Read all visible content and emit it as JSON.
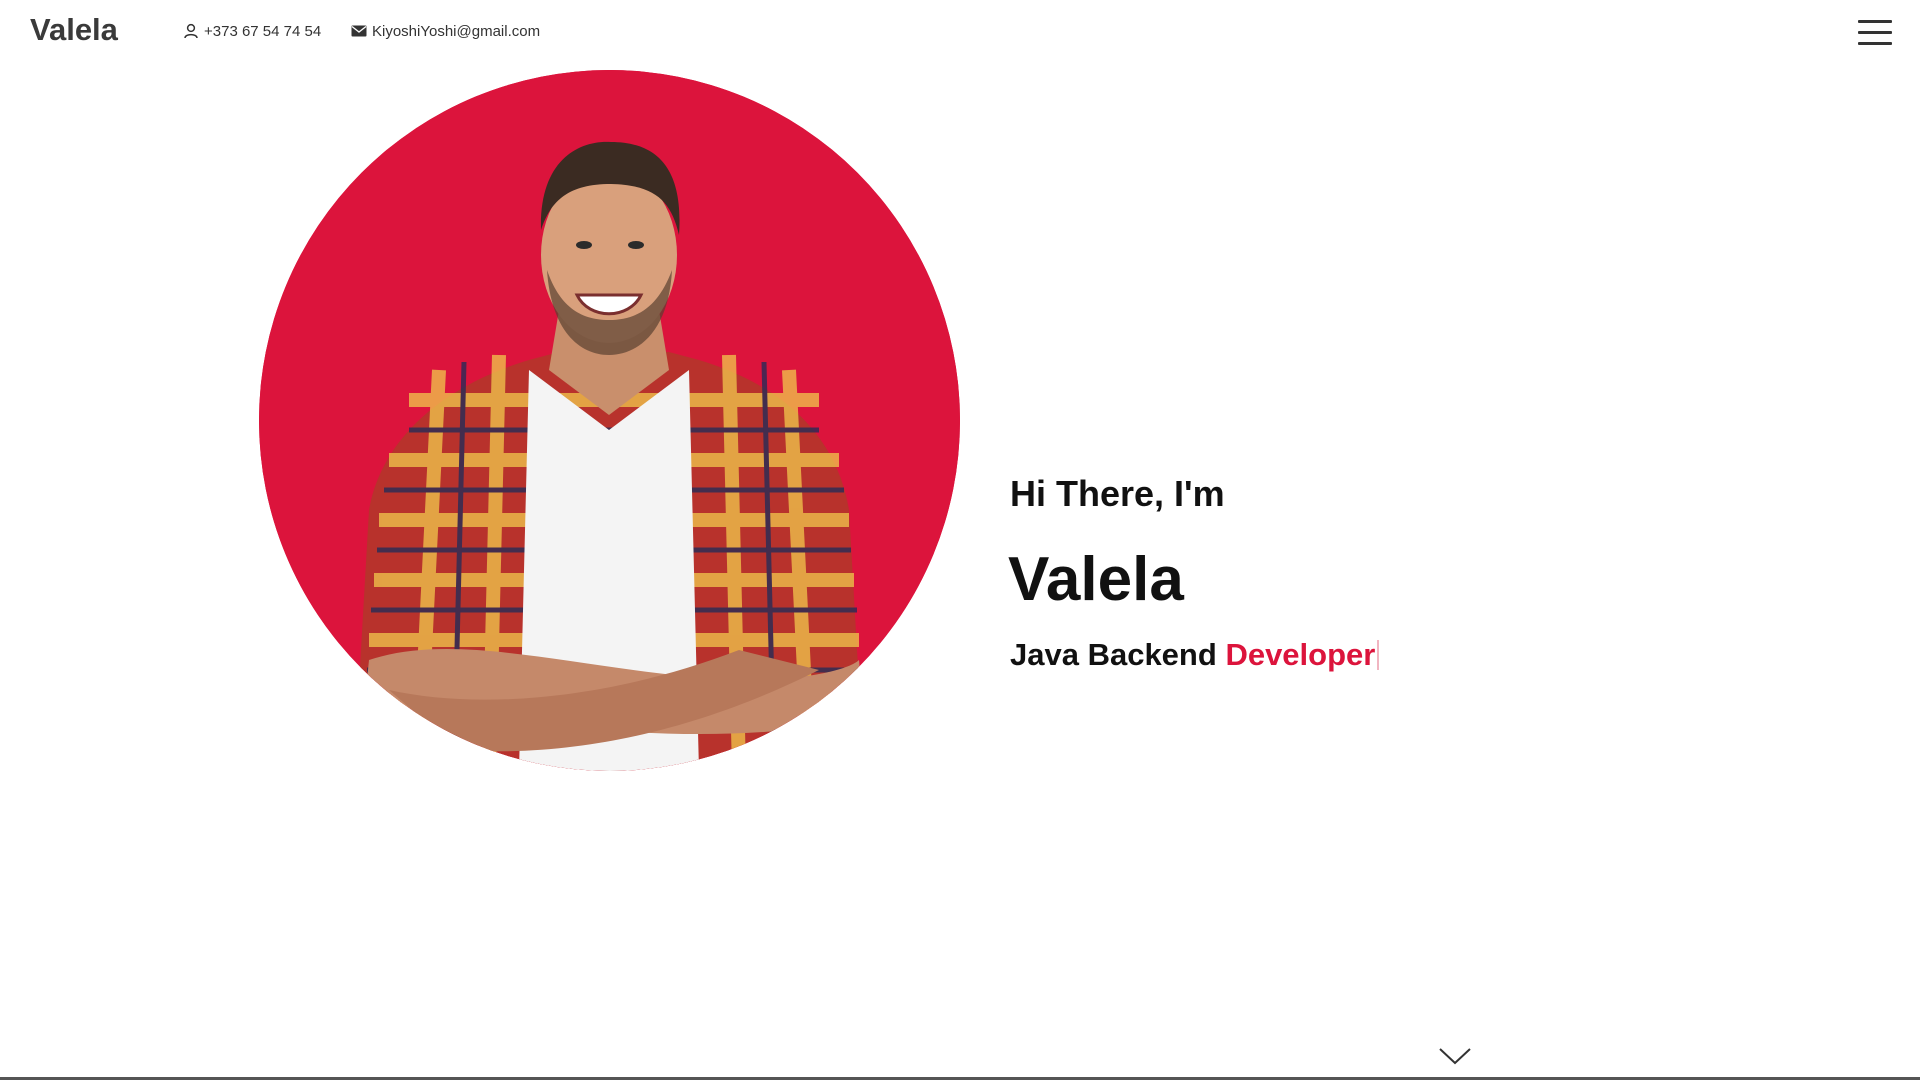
{
  "header": {
    "brand": "Valela",
    "phone": "+373 67 54 74 54",
    "email": "KiyoshiYoshi@gmail.com",
    "phone_icon": "user-icon",
    "email_icon": "envelope-icon",
    "menu_icon": "hamburger-menu-icon"
  },
  "hero": {
    "intro": "Hi There, I'm",
    "name": "Valela",
    "role_prefix": "Java Backend",
    "role_highlight": "Developer"
  },
  "scroll_icon": "chevron-down-icon",
  "colors": {
    "accent": "#dc143c",
    "text": "#111111",
    "background": "#ffffff"
  }
}
